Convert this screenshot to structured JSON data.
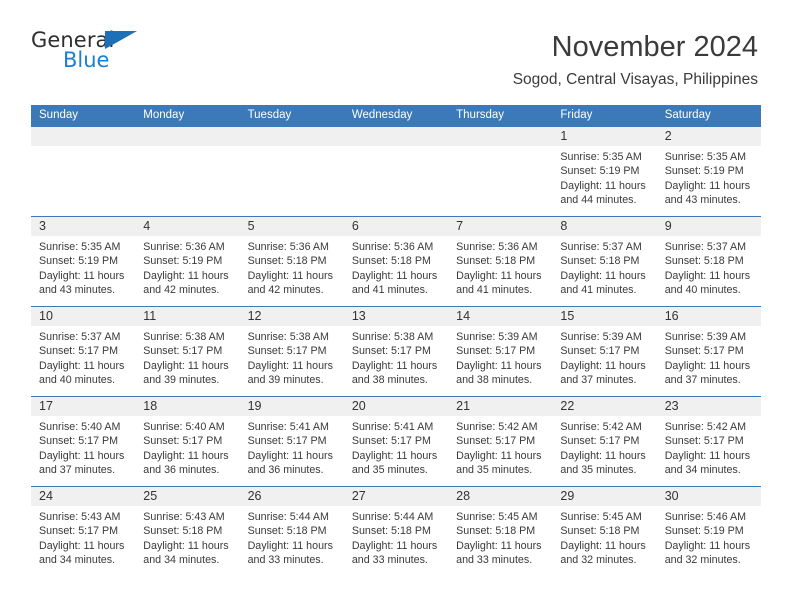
{
  "brand": {
    "name_part1": "General",
    "name_part2": "Blue"
  },
  "header": {
    "title": "November 2024",
    "location": "Sogod, Central Visayas, Philippines"
  },
  "calendar": {
    "weekdays": [
      "Sunday",
      "Monday",
      "Tuesday",
      "Wednesday",
      "Thursday",
      "Friday",
      "Saturday"
    ],
    "colors": {
      "header_blue": "#3b79b8",
      "daynum_band": "#f0f0f0",
      "text": "#3a3a3a",
      "logo_blue": "#1b7fd4"
    },
    "weeks": [
      [
        {
          "day": "",
          "lines": []
        },
        {
          "day": "",
          "lines": []
        },
        {
          "day": "",
          "lines": []
        },
        {
          "day": "",
          "lines": []
        },
        {
          "day": "",
          "lines": []
        },
        {
          "day": "1",
          "lines": [
            "Sunrise: 5:35 AM",
            "Sunset: 5:19 PM",
            "Daylight: 11 hours",
            "and 44 minutes."
          ]
        },
        {
          "day": "2",
          "lines": [
            "Sunrise: 5:35 AM",
            "Sunset: 5:19 PM",
            "Daylight: 11 hours",
            "and 43 minutes."
          ]
        }
      ],
      [
        {
          "day": "3",
          "lines": [
            "Sunrise: 5:35 AM",
            "Sunset: 5:19 PM",
            "Daylight: 11 hours",
            "and 43 minutes."
          ]
        },
        {
          "day": "4",
          "lines": [
            "Sunrise: 5:36 AM",
            "Sunset: 5:19 PM",
            "Daylight: 11 hours",
            "and 42 minutes."
          ]
        },
        {
          "day": "5",
          "lines": [
            "Sunrise: 5:36 AM",
            "Sunset: 5:18 PM",
            "Daylight: 11 hours",
            "and 42 minutes."
          ]
        },
        {
          "day": "6",
          "lines": [
            "Sunrise: 5:36 AM",
            "Sunset: 5:18 PM",
            "Daylight: 11 hours",
            "and 41 minutes."
          ]
        },
        {
          "day": "7",
          "lines": [
            "Sunrise: 5:36 AM",
            "Sunset: 5:18 PM",
            "Daylight: 11 hours",
            "and 41 minutes."
          ]
        },
        {
          "day": "8",
          "lines": [
            "Sunrise: 5:37 AM",
            "Sunset: 5:18 PM",
            "Daylight: 11 hours",
            "and 41 minutes."
          ]
        },
        {
          "day": "9",
          "lines": [
            "Sunrise: 5:37 AM",
            "Sunset: 5:18 PM",
            "Daylight: 11 hours",
            "and 40 minutes."
          ]
        }
      ],
      [
        {
          "day": "10",
          "lines": [
            "Sunrise: 5:37 AM",
            "Sunset: 5:17 PM",
            "Daylight: 11 hours",
            "and 40 minutes."
          ]
        },
        {
          "day": "11",
          "lines": [
            "Sunrise: 5:38 AM",
            "Sunset: 5:17 PM",
            "Daylight: 11 hours",
            "and 39 minutes."
          ]
        },
        {
          "day": "12",
          "lines": [
            "Sunrise: 5:38 AM",
            "Sunset: 5:17 PM",
            "Daylight: 11 hours",
            "and 39 minutes."
          ]
        },
        {
          "day": "13",
          "lines": [
            "Sunrise: 5:38 AM",
            "Sunset: 5:17 PM",
            "Daylight: 11 hours",
            "and 38 minutes."
          ]
        },
        {
          "day": "14",
          "lines": [
            "Sunrise: 5:39 AM",
            "Sunset: 5:17 PM",
            "Daylight: 11 hours",
            "and 38 minutes."
          ]
        },
        {
          "day": "15",
          "lines": [
            "Sunrise: 5:39 AM",
            "Sunset: 5:17 PM",
            "Daylight: 11 hours",
            "and 37 minutes."
          ]
        },
        {
          "day": "16",
          "lines": [
            "Sunrise: 5:39 AM",
            "Sunset: 5:17 PM",
            "Daylight: 11 hours",
            "and 37 minutes."
          ]
        }
      ],
      [
        {
          "day": "17",
          "lines": [
            "Sunrise: 5:40 AM",
            "Sunset: 5:17 PM",
            "Daylight: 11 hours",
            "and 37 minutes."
          ]
        },
        {
          "day": "18",
          "lines": [
            "Sunrise: 5:40 AM",
            "Sunset: 5:17 PM",
            "Daylight: 11 hours",
            "and 36 minutes."
          ]
        },
        {
          "day": "19",
          "lines": [
            "Sunrise: 5:41 AM",
            "Sunset: 5:17 PM",
            "Daylight: 11 hours",
            "and 36 minutes."
          ]
        },
        {
          "day": "20",
          "lines": [
            "Sunrise: 5:41 AM",
            "Sunset: 5:17 PM",
            "Daylight: 11 hours",
            "and 35 minutes."
          ]
        },
        {
          "day": "21",
          "lines": [
            "Sunrise: 5:42 AM",
            "Sunset: 5:17 PM",
            "Daylight: 11 hours",
            "and 35 minutes."
          ]
        },
        {
          "day": "22",
          "lines": [
            "Sunrise: 5:42 AM",
            "Sunset: 5:17 PM",
            "Daylight: 11 hours",
            "and 35 minutes."
          ]
        },
        {
          "day": "23",
          "lines": [
            "Sunrise: 5:42 AM",
            "Sunset: 5:17 PM",
            "Daylight: 11 hours",
            "and 34 minutes."
          ]
        }
      ],
      [
        {
          "day": "24",
          "lines": [
            "Sunrise: 5:43 AM",
            "Sunset: 5:17 PM",
            "Daylight: 11 hours",
            "and 34 minutes."
          ]
        },
        {
          "day": "25",
          "lines": [
            "Sunrise: 5:43 AM",
            "Sunset: 5:18 PM",
            "Daylight: 11 hours",
            "and 34 minutes."
          ]
        },
        {
          "day": "26",
          "lines": [
            "Sunrise: 5:44 AM",
            "Sunset: 5:18 PM",
            "Daylight: 11 hours",
            "and 33 minutes."
          ]
        },
        {
          "day": "27",
          "lines": [
            "Sunrise: 5:44 AM",
            "Sunset: 5:18 PM",
            "Daylight: 11 hours",
            "and 33 minutes."
          ]
        },
        {
          "day": "28",
          "lines": [
            "Sunrise: 5:45 AM",
            "Sunset: 5:18 PM",
            "Daylight: 11 hours",
            "and 33 minutes."
          ]
        },
        {
          "day": "29",
          "lines": [
            "Sunrise: 5:45 AM",
            "Sunset: 5:18 PM",
            "Daylight: 11 hours",
            "and 32 minutes."
          ]
        },
        {
          "day": "30",
          "lines": [
            "Sunrise: 5:46 AM",
            "Sunset: 5:19 PM",
            "Daylight: 11 hours",
            "and 32 minutes."
          ]
        }
      ]
    ]
  }
}
